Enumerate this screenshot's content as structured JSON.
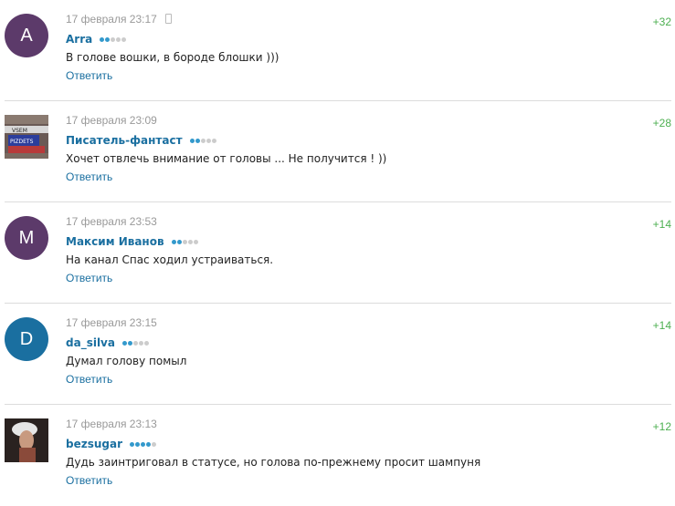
{
  "comments": [
    {
      "avatar_letter": "A",
      "avatar_color": "#5c3a6a",
      "avatar_type": "letter",
      "date": "17 февраля 23:17",
      "device_icon": "phone-icon",
      "author": "Arra",
      "rating_dots_filled": 2,
      "rating_dots_total": 5,
      "text": "В голове вошки, в бороде блошки )))",
      "reply_label": "Ответить",
      "score": "+32"
    },
    {
      "avatar_type": "photo",
      "avatar_text_top": "VSEM",
      "avatar_text_bottom": "PIZDETS",
      "date": "17 февраля 23:09",
      "author": "Писатель-фантаст",
      "rating_dots_filled": 2,
      "rating_dots_total": 5,
      "text": "Хочет отвлечь внимание от головы ... Не получится ! ))",
      "reply_label": "Ответить",
      "score": "+28"
    },
    {
      "avatar_letter": "M",
      "avatar_color": "#5c3a6a",
      "avatar_type": "letter",
      "date": "17 февраля 23:53",
      "author": "Максим Иванов",
      "rating_dots_filled": 2,
      "rating_dots_total": 5,
      "text": "На канал Спас ходил устраиваться.",
      "reply_label": "Ответить",
      "score": "+14"
    },
    {
      "avatar_letter": "D",
      "avatar_color": "#1a6fa0",
      "avatar_type": "letter",
      "date": "17 февраля 23:15",
      "author": "da_silva",
      "rating_dots_filled": 2,
      "rating_dots_total": 5,
      "text": "Думал голову помыл",
      "reply_label": "Ответить",
      "score": "+14"
    },
    {
      "avatar_type": "photo2",
      "date": "17 февраля 23:13",
      "author": "bezsugar",
      "rating_dots_filled": 4,
      "rating_dots_total": 5,
      "text": "Дудь заинтриговал в статусе, но голова по-прежнему просит шампуня",
      "reply_label": "Ответить",
      "score": "+12"
    }
  ]
}
